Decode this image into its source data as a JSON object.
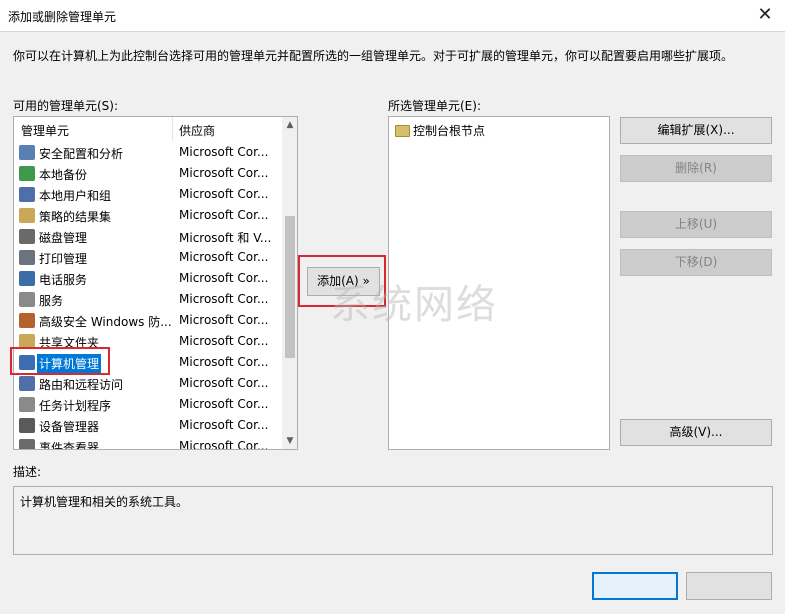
{
  "window": {
    "title": "添加或删除管理单元"
  },
  "intro_text": "你可以在计算机上为此控制台选择可用的管理单元并配置所选的一组管理单元。对于可扩展的管理单元，你可以配置要启用哪些扩展项。",
  "available": {
    "label": "可用的管理单元(S):",
    "columns": {
      "name": "管理单元",
      "vendor": "供应商"
    },
    "rows": [
      {
        "name": "安全配置和分析",
        "vendor": "Microsoft Cor...",
        "icon": "security-analysis-icon",
        "color": "#5a7fb5"
      },
      {
        "name": "本地备份",
        "vendor": "Microsoft Cor...",
        "icon": "backup-icon",
        "color": "#3e9a4b"
      },
      {
        "name": "本地用户和组",
        "vendor": "Microsoft Cor...",
        "icon": "users-groups-icon",
        "color": "#4f6fa8"
      },
      {
        "name": "策略的结果集",
        "vendor": "Microsoft Cor...",
        "icon": "policy-result-icon",
        "color": "#c9a857"
      },
      {
        "name": "磁盘管理",
        "vendor": "Microsoft 和 V...",
        "icon": "disk-icon",
        "color": "#6a6a6a"
      },
      {
        "name": "打印管理",
        "vendor": "Microsoft Cor...",
        "icon": "printer-icon",
        "color": "#6b7280"
      },
      {
        "name": "电话服务",
        "vendor": "Microsoft Cor...",
        "icon": "phone-icon",
        "color": "#3a6ea5"
      },
      {
        "name": "服务",
        "vendor": "Microsoft Cor...",
        "icon": "gear-icon",
        "color": "#8a8a8a"
      },
      {
        "name": "高级安全 Windows 防...",
        "vendor": "Microsoft Cor...",
        "icon": "firewall-icon",
        "color": "#b5612e"
      },
      {
        "name": "共享文件夹",
        "vendor": "Microsoft Cor...",
        "icon": "shared-folder-icon",
        "color": "#c9a857"
      },
      {
        "name": "计算机管理",
        "vendor": "Microsoft Cor...",
        "icon": "computer-management-icon",
        "color": "#3d6db3",
        "selected": true
      },
      {
        "name": "路由和远程访问",
        "vendor": "Microsoft Cor...",
        "icon": "routing-icon",
        "color": "#4f6fa8"
      },
      {
        "name": "任务计划程序",
        "vendor": "Microsoft Cor...",
        "icon": "clock-icon",
        "color": "#8a8a8a"
      },
      {
        "name": "设备管理器",
        "vendor": "Microsoft Cor...",
        "icon": "device-manager-icon",
        "color": "#5a5a5a"
      },
      {
        "name": "事件查看器",
        "vendor": "Microsoft Cor...",
        "icon": "event-viewer-icon",
        "color": "#6b6b6b"
      }
    ]
  },
  "add_button": {
    "label": "添加(A) »"
  },
  "selected": {
    "label": "所选管理单元(E):",
    "items": [
      {
        "name": "控制台根节点",
        "icon": "folder-icon"
      }
    ]
  },
  "buttons": {
    "edit_extensions": "编辑扩展(X)...",
    "remove": "删除(R)",
    "move_up": "上移(U)",
    "move_down": "下移(D)",
    "advanced": "高级(V)..."
  },
  "description": {
    "label": "描述:",
    "text": "计算机管理和相关的系统工具。"
  },
  "watermark": "系统网络",
  "colors": {
    "selection": "#0078d7",
    "highlight_outline": "#d9282f"
  }
}
